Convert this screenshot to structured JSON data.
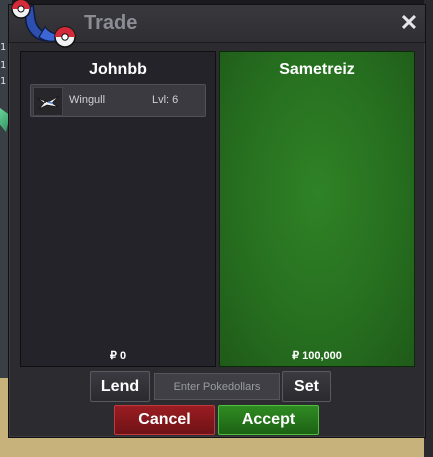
{
  "background": {
    "left_numbers": [
      "1",
      "1",
      "1"
    ]
  },
  "window": {
    "title": "Trade",
    "close_label": "✕"
  },
  "left_panel": {
    "name": "Johnbb",
    "items": [
      {
        "icon": "wingull-sprite-icon",
        "name": "Wingull",
        "level": "Lvl: 6"
      }
    ],
    "money": "₽ 0"
  },
  "right_panel": {
    "name": "Sametreiz",
    "money": "₽ 100,000"
  },
  "controls": {
    "lend_label": "Lend",
    "money_placeholder": "Enter Pokedollars",
    "set_label": "Set",
    "cancel_label": "Cancel",
    "accept_label": "Accept"
  },
  "colors": {
    "accept_green": "#2f8b22",
    "cancel_red": "#9a1d22",
    "partner_panel_green": "#2a7422"
  }
}
